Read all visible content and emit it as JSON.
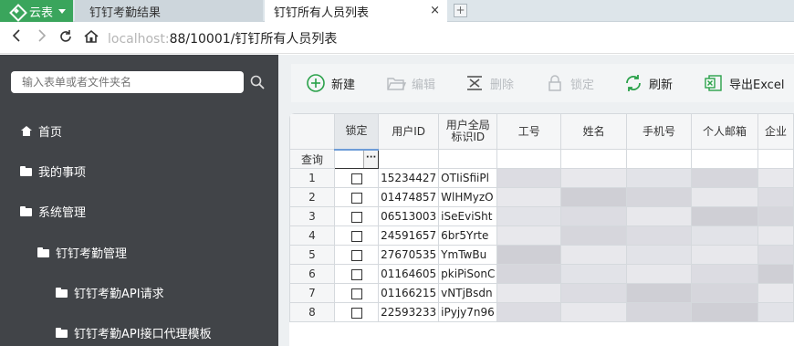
{
  "tabbar": {
    "app_title": "云表",
    "tabs": [
      {
        "label": "钉钉考勤结果"
      },
      {
        "label": "钉钉所有人员列表"
      }
    ],
    "close_glyph": "×",
    "new_tab_glyph": "+"
  },
  "addressbar": {
    "url_host": "localhost:",
    "url_path": "88/10001/钉钉所有人员列表"
  },
  "sidebar": {
    "search_placeholder": "输入表单或者文件夹名",
    "items": [
      {
        "label": "首页",
        "icon": "home-icon"
      },
      {
        "label": "我的事项",
        "icon": "folder-icon"
      },
      {
        "label": "系统管理",
        "icon": "folder-icon"
      },
      {
        "label": "钉钉考勤管理",
        "icon": "folder-icon"
      },
      {
        "label": "钉钉考勤API请求",
        "icon": "folder-icon"
      },
      {
        "label": "钉钉考勤API接口代理模板",
        "icon": "folder-icon"
      }
    ]
  },
  "toolbar": {
    "new_label": "新建",
    "edit_label": "编辑",
    "delete_label": "删除",
    "lock_label": "锁定",
    "refresh_label": "刷新",
    "export_label": "导出Excel"
  },
  "grid": {
    "columns": [
      "锁定",
      "用户ID",
      "用户全局标识ID",
      "工号",
      "姓名",
      "手机号",
      "个人邮箱",
      "企业"
    ],
    "query_label": "查询",
    "filter_glyph": "···",
    "rows": [
      {
        "num": "1",
        "user_id": "15234427",
        "union_id": "OTIiSfiiPl"
      },
      {
        "num": "2",
        "user_id": "01474857",
        "union_id": "WlHMyzO"
      },
      {
        "num": "3",
        "user_id": "06513003",
        "union_id": "iSeEviSht"
      },
      {
        "num": "4",
        "user_id": "24591657",
        "union_id": "6br5Yrte"
      },
      {
        "num": "5",
        "user_id": "27670535",
        "union_id": "YmTwBu"
      },
      {
        "num": "6",
        "user_id": "01164605",
        "union_id": "pkiPiSonC"
      },
      {
        "num": "7",
        "user_id": "01166215",
        "union_id": "vNTjBsdn"
      },
      {
        "num": "8",
        "user_id": "22593233",
        "union_id": "iPyjy7n96"
      }
    ]
  },
  "colors": {
    "app_green": "#3aa55c",
    "sidebar_bg": "#414448",
    "accent_green": "#2aa14a"
  }
}
